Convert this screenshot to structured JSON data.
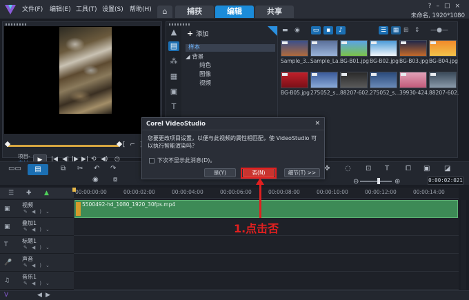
{
  "titlebar": {
    "menus": [
      "文件(F)",
      "编辑(E)",
      "工具(T)",
      "设置(S)",
      "帮助(H)"
    ],
    "tabs": [
      "捕获",
      "编辑",
      "共享"
    ],
    "active_tab": "编辑",
    "project_info": "未命名, 1920*1080"
  },
  "player": {
    "mode_project": "项目-",
    "mode_clip": "素材-"
  },
  "library": {
    "add_label": "添加",
    "folders": [
      "样本",
      "背景",
      "纯色",
      "图像",
      "视频"
    ],
    "thumbnails": [
      {
        "label": "Sample_3...",
        "color_top": "#3a4f8a",
        "color_bottom": "#b06a3c"
      },
      {
        "label": "Sample_La...",
        "color_top": "#5a6f9a",
        "color_bottom": "#9ab3d8"
      },
      {
        "label": "BG-B01.jpg",
        "color_top": "#5aa3e8",
        "color_bottom": "#7bc24a"
      },
      {
        "label": "BG-B02.jpg",
        "color_top": "#4a9ad8",
        "color_bottom": "#f2f6fa"
      },
      {
        "label": "BG-B03.jpg",
        "color_top": "#20284a",
        "color_bottom": "#c46a2a"
      },
      {
        "label": "BG-B04.jpg",
        "color_top": "#f28a2a",
        "color_bottom": "#f2c24a"
      },
      {
        "label": "BG-B05.jpg",
        "color_top": "#c0202a",
        "color_bottom": "#7a1018"
      },
      {
        "label": "275052_s...",
        "color_top": "#3a5a9a",
        "color_bottom": "#8aaad8"
      },
      {
        "label": "88207-602...",
        "color_top": "#2a2a2a",
        "color_bottom": "#5a5a5a"
      },
      {
        "label": "275052_s...",
        "color_top": "#2a4a7a",
        "color_bottom": "#6a8ab8"
      },
      {
        "label": "39930-424...",
        "color_top": "#e2a2b8",
        "color_bottom": "#c25a7a"
      },
      {
        "label": "88207-602...",
        "color_top": "#3a4a5a",
        "color_bottom": "#8a9aaa"
      }
    ]
  },
  "dialog": {
    "title": "Corel VideoStudio",
    "close": "×",
    "message": "您要更改项目设置，以便与此视频的属性相匹配，使 VideoStudio 可以执行智能渲染吗？",
    "checkbox_label": "下次不显示此消息(D)。",
    "btn_yes": "是(Y)",
    "btn_no": "否(N)",
    "btn_details": "细节(T) >>"
  },
  "timeline": {
    "timecode": "0:00:02:021",
    "ticks": [
      "00:00:00:00",
      "00:00:02:00",
      "00:00:04:00",
      "00:00:06:00",
      "00:00:08:00",
      "00:00:10:00",
      "00:00:12:00",
      "00:00:14:00"
    ],
    "tracks": [
      {
        "name": "视频",
        "icon": "video-track-icon"
      },
      {
        "name": "叠加1",
        "icon": "overlay-track-icon"
      },
      {
        "name": "标题1",
        "icon": "title-track-icon"
      },
      {
        "name": "声音",
        "icon": "voice-track-icon"
      },
      {
        "name": "音乐1",
        "icon": "music-track-icon"
      }
    ],
    "clip_label": "5500492-hd_1080_1920_30fps.mp4"
  },
  "annotation": {
    "text": "1.点击否",
    "color": "#e21f1f"
  },
  "colors": {
    "accent": "#1b8bd9",
    "clip": "#3d8a56",
    "highlight": "#e21f1f"
  }
}
